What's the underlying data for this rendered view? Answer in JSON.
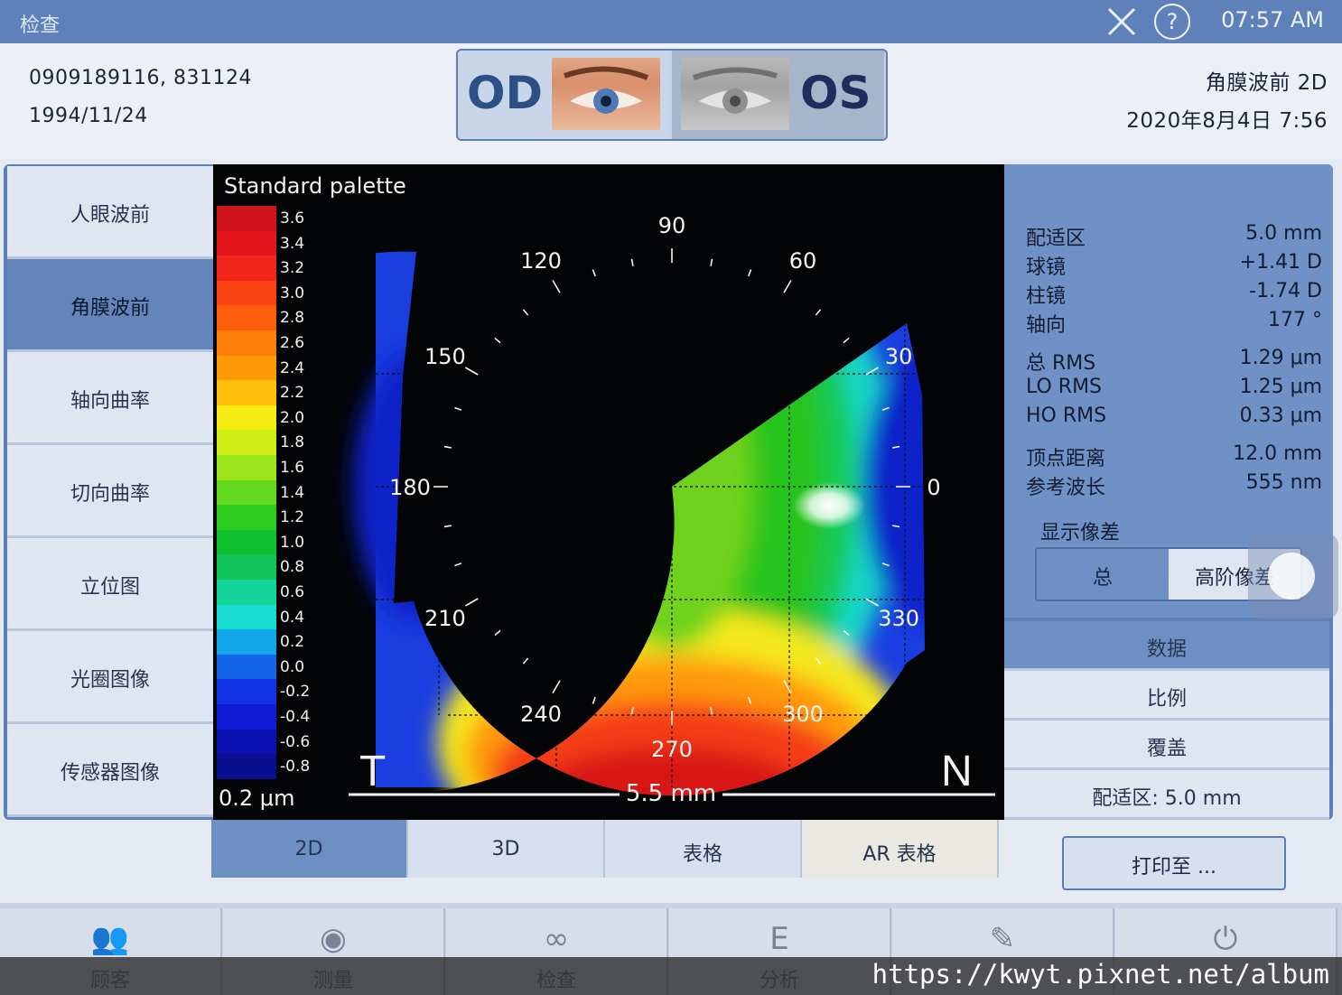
{
  "window": {
    "title": "检查",
    "time": "07:57 AM",
    "close_icon": "close-icon",
    "help_icon": "help-icon",
    "help_glyph": "?"
  },
  "patient": {
    "id": "0909189116, 831124",
    "dob": "1994/11/24"
  },
  "eye_select": {
    "od_label": "OD",
    "os_label": "OS",
    "selected": "OD"
  },
  "exam": {
    "mode": "角膜波前 2D",
    "datetime": "2020年8月4日 7:56"
  },
  "sidebar": {
    "items": [
      {
        "label": "人眼波前",
        "active": false
      },
      {
        "label": "角膜波前",
        "active": true
      },
      {
        "label": "轴向曲率",
        "active": false
      },
      {
        "label": "切向曲率",
        "active": false
      },
      {
        "label": "立位图",
        "active": false
      },
      {
        "label": "光圈图像",
        "active": false
      },
      {
        "label": "传感器图像",
        "active": false
      }
    ]
  },
  "map": {
    "palette_title": "Standard palette",
    "step": "0.2 μm",
    "scale": "5.5 mm",
    "temporal": "T",
    "nasal": "N",
    "palette": [
      {
        "label": "3.6",
        "color": "#d0121a"
      },
      {
        "label": "3.4",
        "color": "#e3141a"
      },
      {
        "label": "3.2",
        "color": "#f2251a"
      },
      {
        "label": "3.0",
        "color": "#fb4212"
      },
      {
        "label": "2.8",
        "color": "#fd5d0c"
      },
      {
        "label": "2.6",
        "color": "#fd7d09"
      },
      {
        "label": "2.4",
        "color": "#fe9a08"
      },
      {
        "label": "2.2",
        "color": "#ffc00a"
      },
      {
        "label": "2.0",
        "color": "#f5ea12"
      },
      {
        "label": "1.8",
        "color": "#cfee16"
      },
      {
        "label": "1.6",
        "color": "#9ee61b"
      },
      {
        "label": "1.4",
        "color": "#63d81e"
      },
      {
        "label": "1.2",
        "color": "#2ccc1f"
      },
      {
        "label": "1.0",
        "color": "#10c02c"
      },
      {
        "label": "0.8",
        "color": "#10c45a"
      },
      {
        "label": "0.6",
        "color": "#14d49a"
      },
      {
        "label": "0.4",
        "color": "#17dcd2"
      },
      {
        "label": "0.2",
        "color": "#13a6e8"
      },
      {
        "label": "0.0",
        "color": "#1565e8"
      },
      {
        "label": "-0.2",
        "color": "#1232e6"
      },
      {
        "label": "-0.4",
        "color": "#0f1bd6"
      },
      {
        "label": "-0.6",
        "color": "#0b12b4"
      },
      {
        "label": "-0.8",
        "color": "#080e8e"
      }
    ],
    "angles": [
      {
        "label": "90",
        "deg": 90
      },
      {
        "label": "60",
        "deg": 60
      },
      {
        "label": "30",
        "deg": 30
      },
      {
        "label": "0",
        "deg": 0
      },
      {
        "label": "330",
        "deg": 330
      },
      {
        "label": "300",
        "deg": 300
      },
      {
        "label": "270",
        "deg": 270
      },
      {
        "label": "240",
        "deg": 240
      },
      {
        "label": "210",
        "deg": 210
      },
      {
        "label": "180",
        "deg": 180
      },
      {
        "label": "150",
        "deg": 150
      },
      {
        "label": "120",
        "deg": 120
      }
    ]
  },
  "data": {
    "rows": [
      {
        "label": "配适区",
        "value": "5.0 mm"
      },
      {
        "label": "球镜",
        "value": "+1.41 D"
      },
      {
        "label": "柱镜",
        "value": "-1.74 D"
      },
      {
        "label": "轴向",
        "value": "177 °"
      },
      {
        "label": "总 RMS",
        "value": "1.29 μm"
      },
      {
        "label": "LO RMS",
        "value": "1.25 μm"
      },
      {
        "label": "HO RMS",
        "value": "0.33 μm"
      },
      {
        "label": "顶点距离",
        "value": "12.0 mm"
      },
      {
        "label": "参考波长",
        "value": "555 nm"
      }
    ],
    "aberration_label": "显示像差",
    "aberration_options": [
      "总",
      "高阶像差"
    ],
    "aberration_selected": "总"
  },
  "right_buttons": [
    "数据",
    "比例",
    "覆盖",
    "配适区: 5.0 mm"
  ],
  "print_button": "打印至 ...",
  "bottom_tabs": [
    {
      "label": "2D",
      "active": true
    },
    {
      "label": "3D",
      "active": false
    },
    {
      "label": "表格",
      "active": false
    },
    {
      "label": "AR 表格",
      "active": false
    }
  ],
  "footer": [
    {
      "label": "顾客",
      "icon": "people-icon"
    },
    {
      "label": "测量",
      "icon": "eye-icon"
    },
    {
      "label": "检查",
      "icon": "lens-icon"
    },
    {
      "label": "分析",
      "icon": "chart-icon"
    },
    {
      "label": "",
      "icon": "wrench-icon"
    },
    {
      "label": "",
      "icon": "power-icon"
    }
  ],
  "watermark": "https://kwyt.pixnet.net/album"
}
